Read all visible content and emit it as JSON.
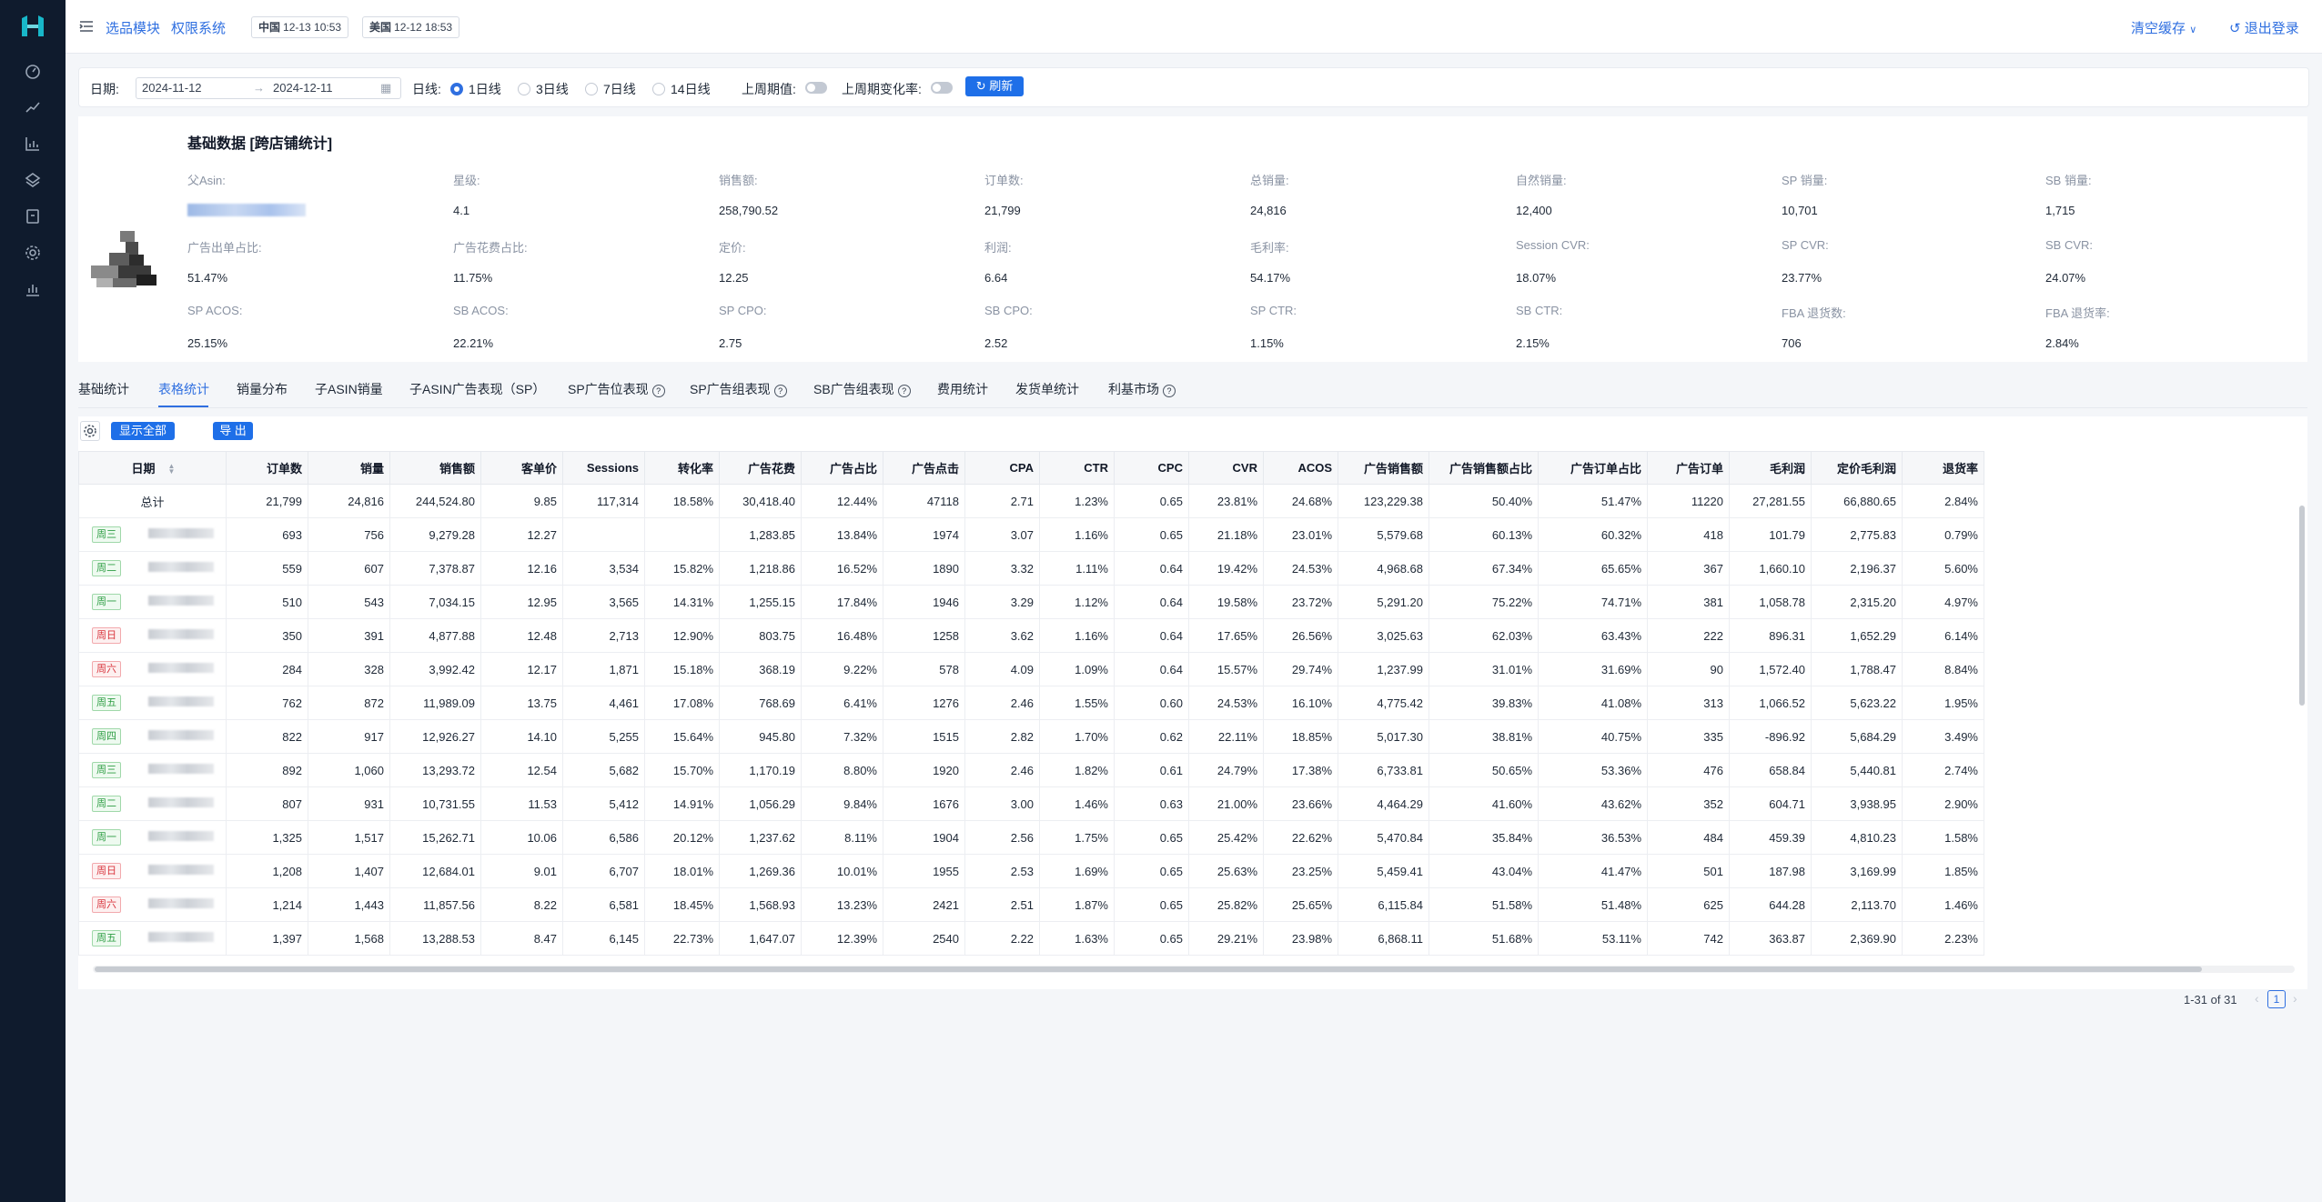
{
  "nav": {
    "menu_links": [
      "选品模块",
      "权限系统"
    ],
    "time_tags": [
      {
        "country": "中国",
        "time": "12-13 10:53"
      },
      {
        "country": "美国",
        "time": "12-12 18:53"
      }
    ],
    "clear_cache": "清空缓存",
    "logout": "退出登录"
  },
  "filter": {
    "date_label": "日期:",
    "start_date": "2024-11-12",
    "end_date": "2024-12-11",
    "line_label": "日线:",
    "line_options": [
      "1日线",
      "3日线",
      "7日线",
      "14日线"
    ],
    "selected_line": "1日线",
    "prev_week_label": "上周期值:",
    "prev_change_label": "上周期变化率:",
    "refresh": "刷新"
  },
  "stats": {
    "title": "基础数据 [跨店铺统计]",
    "rows": [
      [
        {
          "label": "父Asin:",
          "value": ""
        },
        {
          "label": "星级:",
          "value": "4.1"
        },
        {
          "label": "销售额:",
          "value": "258,790.52"
        },
        {
          "label": "订单数:",
          "value": "21,799"
        },
        {
          "label": "总销量:",
          "value": "24,816"
        },
        {
          "label": "自然销量:",
          "value": "12,400"
        },
        {
          "label": "SP 销量:",
          "value": "10,701"
        },
        {
          "label": "SB 销量:",
          "value": "1,715"
        }
      ],
      [
        {
          "label": "广告出单占比:",
          "value": "51.47%"
        },
        {
          "label": "广告花费占比:",
          "value": "11.75%"
        },
        {
          "label": "定价:",
          "value": "12.25"
        },
        {
          "label": "利润:",
          "value": "6.64"
        },
        {
          "label": "毛利率:",
          "value": "54.17%"
        },
        {
          "label": "Session CVR:",
          "value": "18.07%"
        },
        {
          "label": "SP CVR:",
          "value": "23.77%"
        },
        {
          "label": "SB CVR:",
          "value": "24.07%"
        }
      ],
      [
        {
          "label": "SP ACOS:",
          "value": "25.15%"
        },
        {
          "label": "SB ACOS:",
          "value": "22.21%"
        },
        {
          "label": "SP CPO:",
          "value": "2.75"
        },
        {
          "label": "SB CPO:",
          "value": "2.52"
        },
        {
          "label": "SP CTR:",
          "value": "1.15%"
        },
        {
          "label": "SB CTR:",
          "value": "2.15%"
        },
        {
          "label": "FBA 退货数:",
          "value": "706"
        },
        {
          "label": "FBA 退货率:",
          "value": "2.84%"
        }
      ]
    ]
  },
  "tabs": [
    {
      "label": "基础统计",
      "help": false
    },
    {
      "label": "表格统计",
      "help": false
    },
    {
      "label": "销量分布",
      "help": false
    },
    {
      "label": "子ASIN销量",
      "help": false
    },
    {
      "label": "子ASIN广告表现（SP）",
      "help": false
    },
    {
      "label": "SP广告位表现",
      "help": true
    },
    {
      "label": "SP广告组表现",
      "help": true
    },
    {
      "label": "SB广告组表现",
      "help": true
    },
    {
      "label": "费用统计",
      "help": false
    },
    {
      "label": "发货单统计",
      "help": false
    },
    {
      "label": "利基市场",
      "help": true
    }
  ],
  "active_tab": "表格统计",
  "toolbar": {
    "show_all": "显示全部",
    "export": "导 出"
  },
  "table": {
    "columns": [
      "日期",
      "订单数",
      "销量",
      "销售额",
      "客单价",
      "Sessions",
      "转化率",
      "广告花费",
      "广告占比",
      "广告点击",
      "CPA",
      "CTR",
      "CPC",
      "CVR",
      "ACOS",
      "广告销售额",
      "广告销售额占比",
      "广告订单占比",
      "广告订单",
      "毛利润",
      "定价毛利润",
      "退货率"
    ],
    "total": [
      "总计",
      "21,799",
      "24,816",
      "244,524.80",
      "9.85",
      "117,314",
      "18.58%",
      "30,418.40",
      "12.44%",
      "47118",
      "2.71",
      "1.23%",
      "0.65",
      "23.81%",
      "24.68%",
      "123,229.38",
      "50.40%",
      "51.47%",
      "11220",
      "27,281.55",
      "66,880.65",
      "2.84%"
    ],
    "rows": [
      {
        "day": "周三",
        "weekend": false,
        "cells": [
          "693",
          "756",
          "9,279.28",
          "12.27",
          "",
          "",
          "1,283.85",
          "13.84%",
          "1974",
          "3.07",
          "1.16%",
          "0.65",
          "21.18%",
          "23.01%",
          "5,579.68",
          "60.13%",
          "60.32%",
          "418",
          "101.79",
          "2,775.83",
          "0.79%"
        ]
      },
      {
        "day": "周二",
        "weekend": false,
        "cells": [
          "559",
          "607",
          "7,378.87",
          "12.16",
          "3,534",
          "15.82%",
          "1,218.86",
          "16.52%",
          "1890",
          "3.32",
          "1.11%",
          "0.64",
          "19.42%",
          "24.53%",
          "4,968.68",
          "67.34%",
          "65.65%",
          "367",
          "1,660.10",
          "2,196.37",
          "5.60%"
        ]
      },
      {
        "day": "周一",
        "weekend": false,
        "cells": [
          "510",
          "543",
          "7,034.15",
          "12.95",
          "3,565",
          "14.31%",
          "1,255.15",
          "17.84%",
          "1946",
          "3.29",
          "1.12%",
          "0.64",
          "19.58%",
          "23.72%",
          "5,291.20",
          "75.22%",
          "74.71%",
          "381",
          "1,058.78",
          "2,315.20",
          "4.97%"
        ]
      },
      {
        "day": "周日",
        "weekend": true,
        "cells": [
          "350",
          "391",
          "4,877.88",
          "12.48",
          "2,713",
          "12.90%",
          "803.75",
          "16.48%",
          "1258",
          "3.62",
          "1.16%",
          "0.64",
          "17.65%",
          "26.56%",
          "3,025.63",
          "62.03%",
          "63.43%",
          "222",
          "896.31",
          "1,652.29",
          "6.14%"
        ]
      },
      {
        "day": "周六",
        "weekend": true,
        "cells": [
          "284",
          "328",
          "3,992.42",
          "12.17",
          "1,871",
          "15.18%",
          "368.19",
          "9.22%",
          "578",
          "4.09",
          "1.09%",
          "0.64",
          "15.57%",
          "29.74%",
          "1,237.99",
          "31.01%",
          "31.69%",
          "90",
          "1,572.40",
          "1,788.47",
          "8.84%"
        ]
      },
      {
        "day": "周五",
        "weekend": false,
        "cells": [
          "762",
          "872",
          "11,989.09",
          "13.75",
          "4,461",
          "17.08%",
          "768.69",
          "6.41%",
          "1276",
          "2.46",
          "1.55%",
          "0.60",
          "24.53%",
          "16.10%",
          "4,775.42",
          "39.83%",
          "41.08%",
          "313",
          "1,066.52",
          "5,623.22",
          "1.95%"
        ]
      },
      {
        "day": "周四",
        "weekend": false,
        "cells": [
          "822",
          "917",
          "12,926.27",
          "14.10",
          "5,255",
          "15.64%",
          "945.80",
          "7.32%",
          "1515",
          "2.82",
          "1.70%",
          "0.62",
          "22.11%",
          "18.85%",
          "5,017.30",
          "38.81%",
          "40.75%",
          "335",
          "-896.92",
          "5,684.29",
          "3.49%"
        ]
      },
      {
        "day": "周三",
        "weekend": false,
        "cells": [
          "892",
          "1,060",
          "13,293.72",
          "12.54",
          "5,682",
          "15.70%",
          "1,170.19",
          "8.80%",
          "1920",
          "2.46",
          "1.82%",
          "0.61",
          "24.79%",
          "17.38%",
          "6,733.81",
          "50.65%",
          "53.36%",
          "476",
          "658.84",
          "5,440.81",
          "2.74%"
        ]
      },
      {
        "day": "周二",
        "weekend": false,
        "cells": [
          "807",
          "931",
          "10,731.55",
          "11.53",
          "5,412",
          "14.91%",
          "1,056.29",
          "9.84%",
          "1676",
          "3.00",
          "1.46%",
          "0.63",
          "21.00%",
          "23.66%",
          "4,464.29",
          "41.60%",
          "43.62%",
          "352",
          "604.71",
          "3,938.95",
          "2.90%"
        ]
      },
      {
        "day": "周一",
        "weekend": false,
        "cells": [
          "1,325",
          "1,517",
          "15,262.71",
          "10.06",
          "6,586",
          "20.12%",
          "1,237.62",
          "8.11%",
          "1904",
          "2.56",
          "1.75%",
          "0.65",
          "25.42%",
          "22.62%",
          "5,470.84",
          "35.84%",
          "36.53%",
          "484",
          "459.39",
          "4,810.23",
          "1.58%"
        ]
      },
      {
        "day": "周日",
        "weekend": true,
        "cells": [
          "1,208",
          "1,407",
          "12,684.01",
          "9.01",
          "6,707",
          "18.01%",
          "1,269.36",
          "10.01%",
          "1955",
          "2.53",
          "1.69%",
          "0.65",
          "25.63%",
          "23.25%",
          "5,459.41",
          "43.04%",
          "41.47%",
          "501",
          "187.98",
          "3,169.99",
          "1.85%"
        ]
      },
      {
        "day": "周六",
        "weekend": true,
        "cells": [
          "1,214",
          "1,443",
          "11,857.56",
          "8.22",
          "6,581",
          "18.45%",
          "1,568.93",
          "13.23%",
          "2421",
          "2.51",
          "1.87%",
          "0.65",
          "25.82%",
          "25.65%",
          "6,115.84",
          "51.58%",
          "51.48%",
          "625",
          "644.28",
          "2,113.70",
          "1.46%"
        ]
      },
      {
        "day": "周五",
        "weekend": false,
        "cells": [
          "1,397",
          "1,568",
          "13,288.53",
          "8.47",
          "6,145",
          "22.73%",
          "1,647.07",
          "12.39%",
          "2540",
          "2.22",
          "1.63%",
          "0.65",
          "29.21%",
          "23.98%",
          "6,868.11",
          "51.68%",
          "53.11%",
          "742",
          "363.87",
          "2,369.90",
          "2.23%"
        ]
      }
    ]
  },
  "pagination": {
    "range": "1-31 of 31",
    "page": "1"
  }
}
